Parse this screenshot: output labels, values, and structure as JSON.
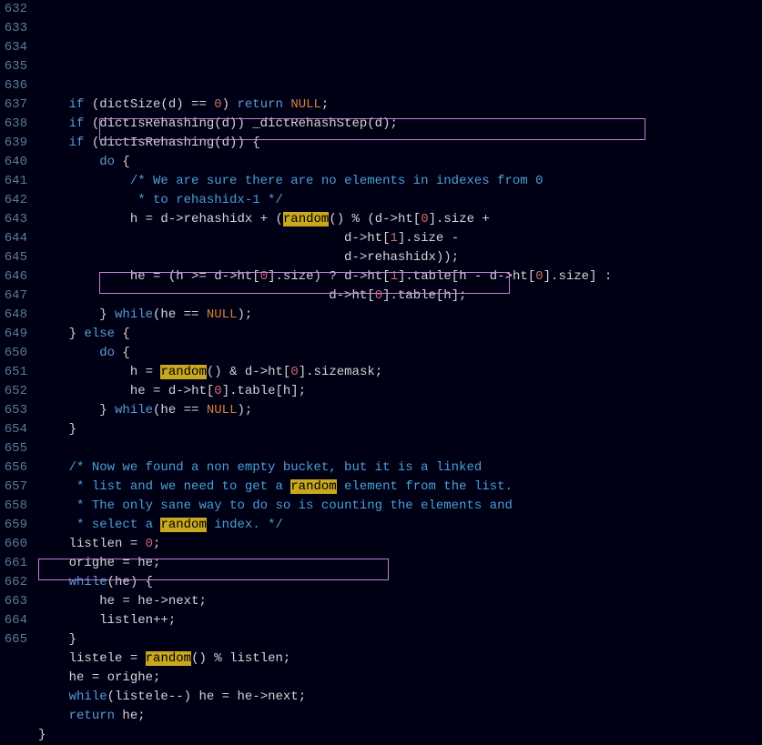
{
  "lines": [
    {
      "num": "632",
      "tokens": [
        {
          "t": "    "
        },
        {
          "t": "if",
          "c": "kw"
        },
        {
          "t": " (dictSize(d) "
        },
        {
          "t": "==",
          "c": "op"
        },
        {
          "t": " "
        },
        {
          "t": "0",
          "c": "num"
        },
        {
          "t": ") "
        },
        {
          "t": "return",
          "c": "kw"
        },
        {
          "t": " "
        },
        {
          "t": "NULL",
          "c": "null"
        },
        {
          "t": ";"
        }
      ]
    },
    {
      "num": "633",
      "tokens": [
        {
          "t": "    "
        },
        {
          "t": "if",
          "c": "kw"
        },
        {
          "t": " (dictIsRehashing(d)) _dictRehashStep(d);"
        }
      ]
    },
    {
      "num": "634",
      "tokens": [
        {
          "t": "    "
        },
        {
          "t": "if",
          "c": "kw"
        },
        {
          "t": " (dictIsRehashing(d)) {"
        }
      ]
    },
    {
      "num": "635",
      "tokens": [
        {
          "t": "        "
        },
        {
          "t": "do",
          "c": "kw"
        },
        {
          "t": " {"
        }
      ]
    },
    {
      "num": "636",
      "tokens": [
        {
          "t": "            "
        },
        {
          "t": "/* We are sure there are no elements in indexes from 0",
          "c": "comment"
        }
      ]
    },
    {
      "num": "637",
      "tokens": [
        {
          "t": "             "
        },
        {
          "t": "* to rehashidx-1 */",
          "c": "comment"
        }
      ]
    },
    {
      "num": "638",
      "tokens": [
        {
          "t": "            h "
        },
        {
          "t": "=",
          "c": "op"
        },
        {
          "t": " d"
        },
        {
          "t": "->",
          "c": "op"
        },
        {
          "t": "rehashidx "
        },
        {
          "t": "+",
          "c": "op"
        },
        {
          "t": " ("
        },
        {
          "t": "random",
          "c": "hl"
        },
        {
          "t": "() "
        },
        {
          "t": "%",
          "c": "op"
        },
        {
          "t": " (d"
        },
        {
          "t": "->",
          "c": "op"
        },
        {
          "t": "ht["
        },
        {
          "t": "0",
          "c": "num"
        },
        {
          "t": "].size "
        },
        {
          "t": "+",
          "c": "op"
        }
      ]
    },
    {
      "num": "639",
      "tokens": [
        {
          "t": "                                        d"
        },
        {
          "t": "->",
          "c": "op"
        },
        {
          "t": "ht["
        },
        {
          "t": "1",
          "c": "num"
        },
        {
          "t": "].size "
        },
        {
          "t": "-",
          "c": "op"
        }
      ]
    },
    {
      "num": "640",
      "tokens": [
        {
          "t": "                                        d"
        },
        {
          "t": "->",
          "c": "op"
        },
        {
          "t": "rehashidx));"
        }
      ]
    },
    {
      "num": "641",
      "tokens": [
        {
          "t": "            he "
        },
        {
          "t": "=",
          "c": "op"
        },
        {
          "t": " (h "
        },
        {
          "t": ">=",
          "c": "op"
        },
        {
          "t": " d"
        },
        {
          "t": "->",
          "c": "op"
        },
        {
          "t": "ht["
        },
        {
          "t": "0",
          "c": "num"
        },
        {
          "t": "].size) "
        },
        {
          "t": "?",
          "c": "op"
        },
        {
          "t": " d"
        },
        {
          "t": "->",
          "c": "op"
        },
        {
          "t": "ht["
        },
        {
          "t": "1",
          "c": "num"
        },
        {
          "t": "].table[h "
        },
        {
          "t": "-",
          "c": "op"
        },
        {
          "t": " d"
        },
        {
          "t": "->",
          "c": "op"
        },
        {
          "t": "ht["
        },
        {
          "t": "0",
          "c": "num"
        },
        {
          "t": "].size] "
        },
        {
          "t": ":",
          "c": "op"
        }
      ]
    },
    {
      "num": "642",
      "tokens": [
        {
          "t": "                                      d"
        },
        {
          "t": "->",
          "c": "op"
        },
        {
          "t": "ht["
        },
        {
          "t": "0",
          "c": "num"
        },
        {
          "t": "].table[h];"
        }
      ]
    },
    {
      "num": "643",
      "tokens": [
        {
          "t": "        } "
        },
        {
          "t": "while",
          "c": "kw"
        },
        {
          "t": "(he "
        },
        {
          "t": "==",
          "c": "op"
        },
        {
          "t": " "
        },
        {
          "t": "NULL",
          "c": "null"
        },
        {
          "t": ");"
        }
      ]
    },
    {
      "num": "644",
      "tokens": [
        {
          "t": "    } "
        },
        {
          "t": "else",
          "c": "kw"
        },
        {
          "t": " {"
        }
      ]
    },
    {
      "num": "645",
      "tokens": [
        {
          "t": "        "
        },
        {
          "t": "do",
          "c": "kw"
        },
        {
          "t": " {"
        }
      ]
    },
    {
      "num": "646",
      "tokens": [
        {
          "t": "            h "
        },
        {
          "t": "=",
          "c": "op"
        },
        {
          "t": " "
        },
        {
          "t": "random",
          "c": "hl"
        },
        {
          "t": "() "
        },
        {
          "t": "&",
          "c": "op"
        },
        {
          "t": " d"
        },
        {
          "t": "->",
          "c": "op"
        },
        {
          "t": "ht["
        },
        {
          "t": "0",
          "c": "num"
        },
        {
          "t": "].sizemask;"
        }
      ]
    },
    {
      "num": "647",
      "tokens": [
        {
          "t": "            he "
        },
        {
          "t": "=",
          "c": "op"
        },
        {
          "t": " d"
        },
        {
          "t": "->",
          "c": "op"
        },
        {
          "t": "ht["
        },
        {
          "t": "0",
          "c": "num"
        },
        {
          "t": "].table[h];"
        }
      ]
    },
    {
      "num": "648",
      "tokens": [
        {
          "t": "        } "
        },
        {
          "t": "while",
          "c": "kw"
        },
        {
          "t": "(he "
        },
        {
          "t": "==",
          "c": "op"
        },
        {
          "t": " "
        },
        {
          "t": "NULL",
          "c": "null"
        },
        {
          "t": ");"
        }
      ]
    },
    {
      "num": "649",
      "tokens": [
        {
          "t": "    }"
        }
      ]
    },
    {
      "num": "650",
      "tokens": [
        {
          "t": ""
        }
      ]
    },
    {
      "num": "651",
      "tokens": [
        {
          "t": "    "
        },
        {
          "t": "/* Now we found a non empty bucket, but it is a linked",
          "c": "comment"
        }
      ]
    },
    {
      "num": "652",
      "tokens": [
        {
          "t": "     "
        },
        {
          "t": "* list and we need to get a ",
          "c": "comment"
        },
        {
          "t": "random",
          "c": "hl"
        },
        {
          "t": " element from the list.",
          "c": "comment"
        }
      ]
    },
    {
      "num": "653",
      "tokens": [
        {
          "t": "     "
        },
        {
          "t": "* The only sane way to do so is counting the elements and",
          "c": "comment"
        }
      ]
    },
    {
      "num": "654",
      "tokens": [
        {
          "t": "     "
        },
        {
          "t": "* select a ",
          "c": "comment"
        },
        {
          "t": "random",
          "c": "hl"
        },
        {
          "t": " index. */",
          "c": "comment"
        }
      ]
    },
    {
      "num": "655",
      "tokens": [
        {
          "t": "    listlen "
        },
        {
          "t": "=",
          "c": "op"
        },
        {
          "t": " "
        },
        {
          "t": "0",
          "c": "num"
        },
        {
          "t": ";"
        }
      ]
    },
    {
      "num": "656",
      "tokens": [
        {
          "t": "    orighe "
        },
        {
          "t": "=",
          "c": "op"
        },
        {
          "t": " he;"
        }
      ]
    },
    {
      "num": "657",
      "tokens": [
        {
          "t": "    "
        },
        {
          "t": "while",
          "c": "kw"
        },
        {
          "t": "(he) {"
        }
      ]
    },
    {
      "num": "658",
      "tokens": [
        {
          "t": "        he "
        },
        {
          "t": "=",
          "c": "op"
        },
        {
          "t": " he"
        },
        {
          "t": "->",
          "c": "op"
        },
        {
          "t": "next;"
        }
      ]
    },
    {
      "num": "659",
      "tokens": [
        {
          "t": "        listlen"
        },
        {
          "t": "++",
          "c": "op"
        },
        {
          "t": ";"
        }
      ]
    },
    {
      "num": "660",
      "tokens": [
        {
          "t": "    }"
        }
      ]
    },
    {
      "num": "661",
      "tokens": [
        {
          "t": "    listele "
        },
        {
          "t": "=",
          "c": "op"
        },
        {
          "t": " "
        },
        {
          "t": "random",
          "c": "hl"
        },
        {
          "t": "() "
        },
        {
          "t": "%",
          "c": "op"
        },
        {
          "t": " listlen;"
        }
      ]
    },
    {
      "num": "662",
      "tokens": [
        {
          "t": "    he "
        },
        {
          "t": "=",
          "c": "op"
        },
        {
          "t": " orighe;"
        }
      ]
    },
    {
      "num": "663",
      "tokens": [
        {
          "t": "    "
        },
        {
          "t": "while",
          "c": "kw"
        },
        {
          "t": "(listele"
        },
        {
          "t": "--",
          "c": "op"
        },
        {
          "t": ") he "
        },
        {
          "t": "=",
          "c": "op"
        },
        {
          "t": " he"
        },
        {
          "t": "->",
          "c": "op"
        },
        {
          "t": "next;"
        }
      ]
    },
    {
      "num": "664",
      "tokens": [
        {
          "t": "    "
        },
        {
          "t": "return",
          "c": "kw"
        },
        {
          "t": " he;"
        }
      ]
    },
    {
      "num": "665",
      "tokens": [
        {
          "t": "}"
        }
      ]
    }
  ]
}
